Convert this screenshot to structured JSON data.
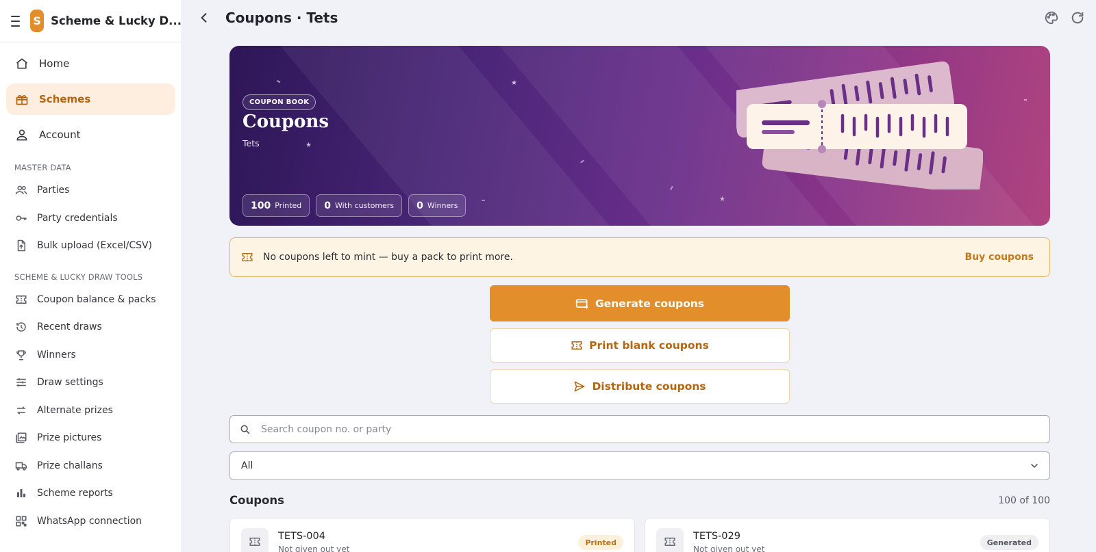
{
  "app": {
    "logo_letter": "S",
    "name": "Scheme & Lucky D..."
  },
  "nav": {
    "main": [
      {
        "label": "Home",
        "icon": "home-icon"
      },
      {
        "label": "Schemes",
        "icon": "gift-icon",
        "active": true
      },
      {
        "label": "Account",
        "icon": "user-icon"
      }
    ],
    "master_label": "MASTER DATA",
    "master": [
      {
        "label": "Parties",
        "icon": "people-icon"
      },
      {
        "label": "Party credentials",
        "icon": "key-icon"
      },
      {
        "label": "Bulk upload (Excel/CSV)",
        "icon": "file-upload-icon"
      }
    ],
    "tools_label": "SCHEME & LUCKY DRAW TOOLS",
    "tools": [
      {
        "label": "Coupon balance & packs",
        "icon": "ticket-icon"
      },
      {
        "label": "Recent draws",
        "icon": "history-icon"
      },
      {
        "label": "Winners",
        "icon": "trophy-icon"
      },
      {
        "label": "Draw settings",
        "icon": "sliders-icon"
      },
      {
        "label": "Alternate prizes",
        "icon": "swap-icon"
      },
      {
        "label": "Prize pictures",
        "icon": "image-icon"
      },
      {
        "label": "Prize challans",
        "icon": "truck-icon"
      },
      {
        "label": "Scheme reports",
        "icon": "bar-chart-icon"
      },
      {
        "label": "WhatsApp connection",
        "icon": "qr-icon"
      }
    ]
  },
  "header": {
    "title": "Coupons · Tets"
  },
  "hero": {
    "badge": "COUPON BOOK",
    "title": "Coupons",
    "subtitle": "Tets",
    "stats": [
      {
        "value": "100",
        "label": "Printed"
      },
      {
        "value": "0",
        "label": "With customers"
      },
      {
        "value": "0",
        "label": "Winners"
      }
    ]
  },
  "alert": {
    "message": "No coupons left to mint — buy a pack to print more.",
    "action": "Buy coupons"
  },
  "actions": {
    "generate": "Generate coupons",
    "print": "Print blank coupons",
    "distribute": "Distribute coupons"
  },
  "search": {
    "placeholder": "Search coupon no. or party"
  },
  "filter": {
    "selected": "All"
  },
  "coupons": {
    "title": "Coupons",
    "count": "100 of 100",
    "items": [
      {
        "code": "TETS-004",
        "status_text": "Not given out yet",
        "badge": "Printed"
      },
      {
        "code": "TETS-029",
        "status_text": "Not given out yet",
        "badge": "Generated"
      }
    ]
  },
  "colors": {
    "accent": "#e28e2b",
    "hero_start": "#2d1657",
    "hero_end": "#b0447f",
    "alert_bg": "#fdf4e4"
  }
}
